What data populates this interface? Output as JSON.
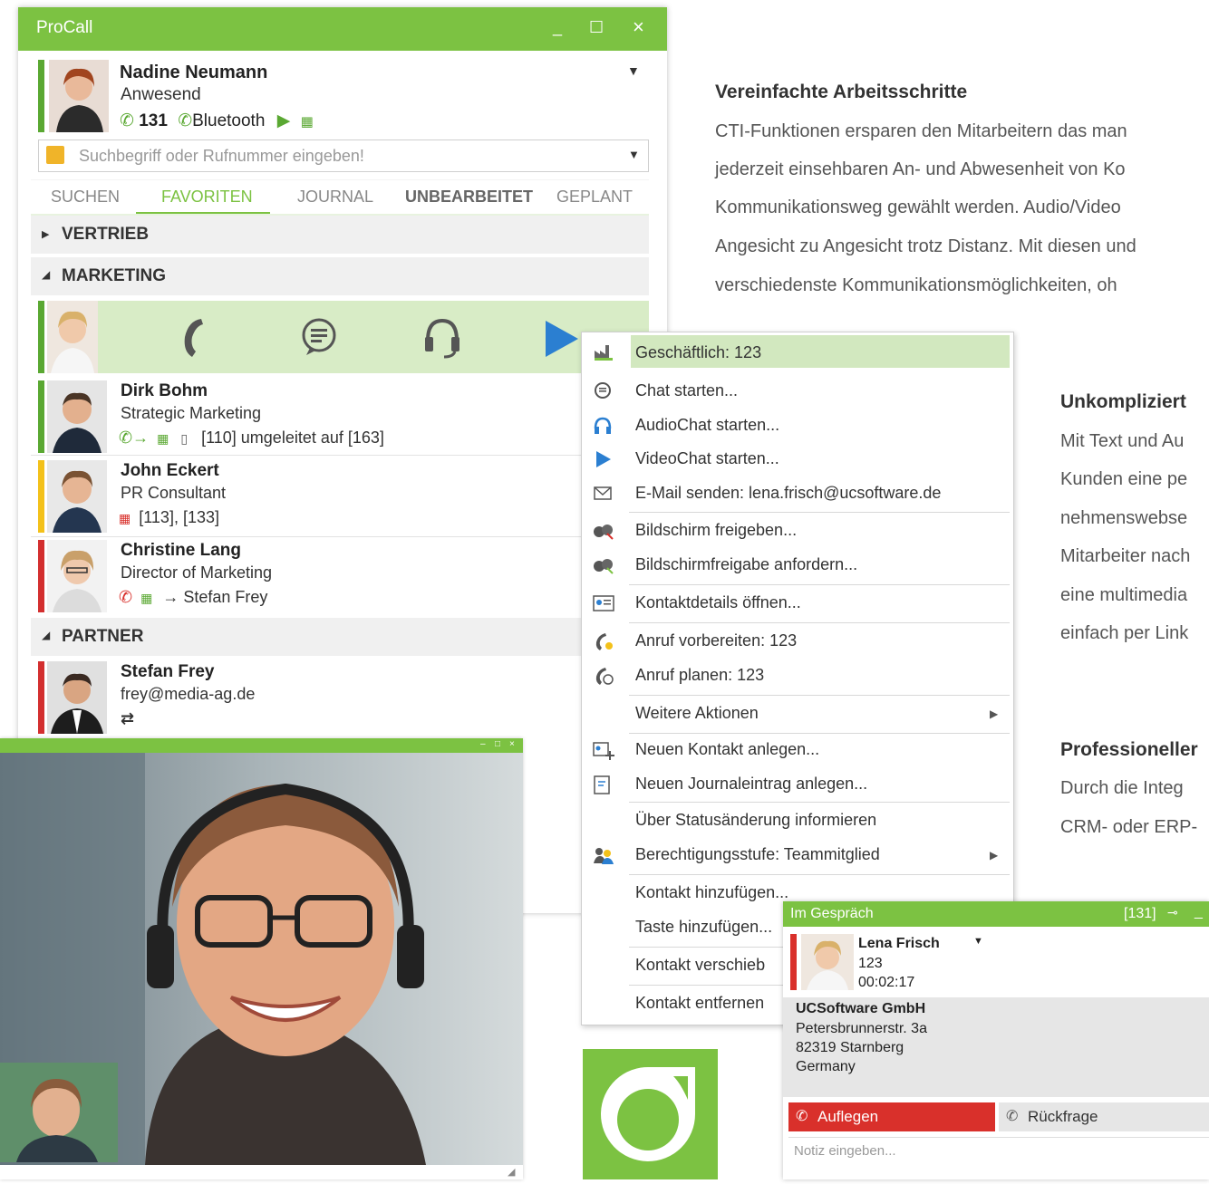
{
  "marketing": {
    "section1": {
      "title": "Vereinfachte Arbeitsschritte",
      "lines": [
        "CTI-Funktionen ersparen den Mitarbeitern das man",
        "jederzeit einsehbaren An- und Abwesenheit von Ko",
        "Kommunikationsweg gewählt werden. Audio/Video",
        "Angesicht zu Angesicht trotz Distanz. Mit diesen und",
        "verschiedenste Kommunikationsmöglichkeiten, oh"
      ]
    },
    "section2": {
      "title": "Unkompliziert",
      "lines": [
        "Mit Text und Au",
        "Kunden eine pe",
        "nehmenswebse",
        "Mitarbeiter nach",
        "eine multimedia",
        "einfach per Link"
      ]
    },
    "section3": {
      "title": "Professioneller",
      "lines": [
        "Durch die Integ",
        "CRM- oder ERP-"
      ]
    }
  },
  "procall": {
    "title": "ProCall",
    "window_buttons": {
      "minimize": "_",
      "maximize": "☐",
      "close": "×"
    },
    "user": {
      "name": "Nadine Neumann",
      "status": "Anwesend",
      "line": "131",
      "device": "Bluetooth"
    },
    "search": {
      "placeholder": "Suchbegriff oder Rufnummer eingeben!"
    },
    "tabs": [
      "SUCHEN",
      "FAVORITEN",
      "JOURNAL",
      "UNBEARBEITET",
      "GEPLANT"
    ],
    "active_tab": "FAVORITEN",
    "groups": {
      "vertrieb": "VERTRIEB",
      "marketing": "MARKETING",
      "partner": "PARTNER"
    },
    "contacts": [
      {
        "name": "Dirk Bohm",
        "role": "Strategic Marketing",
        "status": "[110] umgeleitet auf [163]",
        "presence_color": "#5aa832"
      },
      {
        "name": "John Eckert",
        "role": "PR Consultant",
        "status": "[113], [133]",
        "presence_color": "#f3c11a"
      },
      {
        "name": "Christine Lang",
        "role": "Director of Marketing",
        "status": "→ Stefan Frey",
        "presence_color": "#d32f2f"
      },
      {
        "name": "Stefan Frey",
        "role": "frey@media-ag.de",
        "status": "",
        "presence_color": "#d32f2f"
      }
    ]
  },
  "context_menu": {
    "items": [
      "Geschäftlich: 123",
      "Chat starten...",
      "AudioChat starten...",
      "VideoChat starten...",
      "E-Mail senden: lena.frisch@ucsoftware.de",
      "Bildschirm freigeben...",
      "Bildschirmfreigabe anfordern...",
      "Kontaktdetails öffnen...",
      "Anruf vorbereiten: 123",
      "Anruf planen: 123",
      "Weitere Aktionen",
      "Neuen Kontakt anlegen...",
      "Neuen Journaleintrag anlegen...",
      "Über Statusänderung informieren",
      "Berechtigungsstufe: Teammitglied",
      "Kontakt hinzufügen...",
      "Taste hinzufügen...",
      "Kontakt verschieb",
      "Kontakt entfernen"
    ]
  },
  "call": {
    "title": "Im Gespräch",
    "line": "[131]",
    "name": "Lena Frisch",
    "number": "123",
    "duration": "00:02:17",
    "company": "UCSoftware GmbH",
    "street": "Petersbrunnerstr. 3a",
    "city": "82319 Starnberg",
    "country": "Germany",
    "hangup_label": "Auflegen",
    "consult_label": "Rückfrage",
    "note_placeholder": "Notiz eingeben..."
  },
  "colors": {
    "brand_green": "#7cc242",
    "red": "#d9302b",
    "yellow": "#f3c11a"
  }
}
